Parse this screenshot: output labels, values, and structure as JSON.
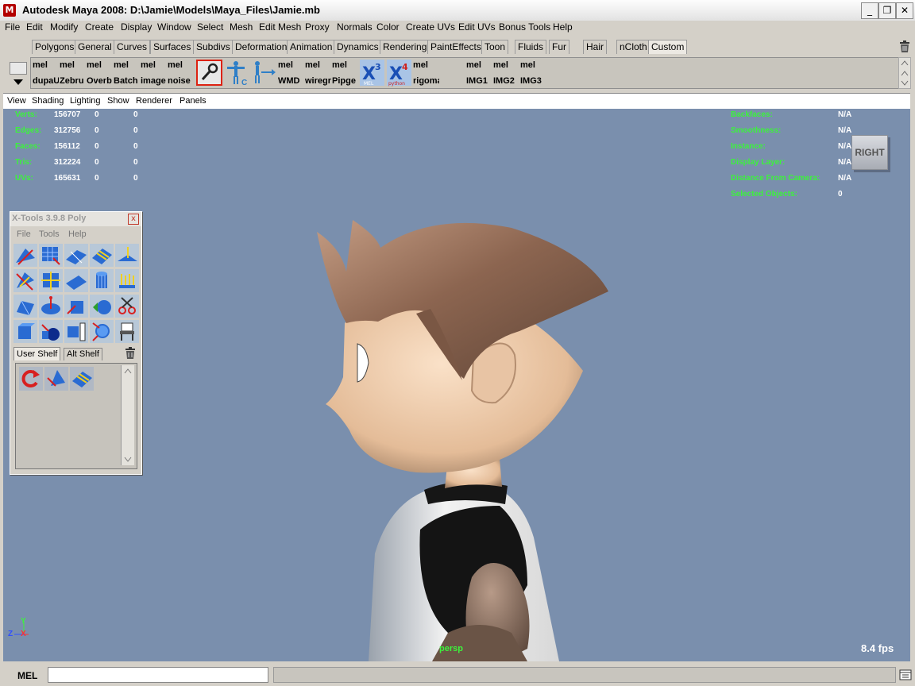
{
  "window": {
    "title": "Autodesk Maya 2008: D:\\Jamie\\Models\\Maya_Files\\Jamie.mb",
    "app_icon_letter": "M",
    "min_glyph": "_",
    "max_glyph": "❐",
    "close_glyph": "✕"
  },
  "menubar": {
    "items": [
      "File",
      "Edit",
      "Modify",
      "Create",
      "Display",
      "Window",
      "Select",
      "Mesh",
      "Edit Mesh",
      "Proxy",
      "Normals",
      "Color",
      "Create UVs",
      "Edit UVs",
      "Bonus Tools",
      "Help"
    ]
  },
  "shelf_tabs": {
    "items": [
      "Polygons",
      "General",
      "Curves",
      "Surfaces",
      "Subdivs",
      "Deformation",
      "Animation",
      "Dynamics",
      "Rendering",
      "PaintEffects",
      "Toon",
      "Fluids",
      "Fur",
      "Hair",
      "nCloth",
      "Custom"
    ],
    "active": "Custom",
    "trash_icon": "trash-icon"
  },
  "shelf": {
    "mel_tag": "mel",
    "buttons": [
      {
        "label": "dupaU"
      },
      {
        "label": "Zebru"
      },
      {
        "label": "Overb"
      },
      {
        "label": "Batch"
      },
      {
        "label": "image"
      },
      {
        "label": "noise"
      },
      {
        "label": "WMD"
      },
      {
        "label": "wiregr"
      },
      {
        "label": "Pipge"
      },
      {
        "label": "rigoma"
      },
      {
        "label": "IMG1"
      },
      {
        "label": "IMG2"
      },
      {
        "label": "IMG3"
      }
    ],
    "icon_buttons": [
      "wrench-icon",
      "character-c-icon",
      "character-arrow-icon",
      "x3-mel-icon",
      "x4-python-icon"
    ],
    "x3_number": "3",
    "x3_sub": "MEL",
    "x4_number": "4",
    "x4_sub": "python"
  },
  "panel_menu": {
    "items": [
      "View",
      "Shading",
      "Lighting",
      "Show",
      "Renderer",
      "Panels"
    ]
  },
  "hud_left": {
    "rows": [
      {
        "label": "Verts:",
        "a": "156707",
        "b": "0",
        "c": "0"
      },
      {
        "label": "Edges:",
        "a": "312756",
        "b": "0",
        "c": "0"
      },
      {
        "label": "Faces:",
        "a": "156112",
        "b": "0",
        "c": "0"
      },
      {
        "label": "Tris:",
        "a": "312224",
        "b": "0",
        "c": "0"
      },
      {
        "label": "UVs:",
        "a": "165631",
        "b": "0",
        "c": "0"
      }
    ]
  },
  "hud_right": {
    "rows": [
      {
        "label": "Backfaces:",
        "value": "N/A"
      },
      {
        "label": "Smoothness:",
        "value": "N/A"
      },
      {
        "label": "Instance:",
        "value": "N/A"
      },
      {
        "label": "Display Layer:",
        "value": "N/A"
      },
      {
        "label": "Distance From Camera:",
        "value": "N/A"
      },
      {
        "label": "Selected Objects:",
        "value": "0"
      }
    ]
  },
  "view_cube": {
    "label": "RIGHT"
  },
  "camera": {
    "name": "persp"
  },
  "fps": "8.4 fps",
  "axis": {
    "y": "Y",
    "z": "Z",
    "x": "X"
  },
  "xtools": {
    "title": "X-Tools 3.9.8 Poly",
    "menu": [
      "File",
      "Tools",
      "Help"
    ],
    "tabs": [
      "User Shelf",
      "Alt Shelf"
    ],
    "close_glyph": "x"
  },
  "cmdline": {
    "label": "MEL",
    "value": ""
  },
  "colors": {
    "viewport_bg": "#7a8fad",
    "hud_green": "#3cf23c",
    "ui_gray": "#d4d0c8"
  }
}
